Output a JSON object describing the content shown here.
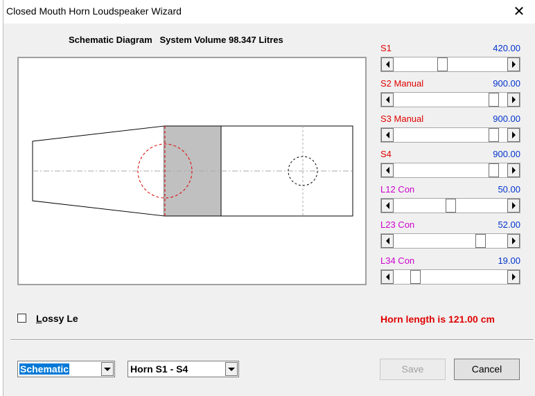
{
  "window": {
    "title": "Closed Mouth Horn Loudspeaker Wizard",
    "close_glyph": "✕"
  },
  "diagram": {
    "heading": "Schematic Diagram   System Volume 98.347 Litres"
  },
  "sliders": [
    {
      "label": "S1",
      "value": "420.00",
      "color": "#e00000",
      "level": 0.42
    },
    {
      "label": "S2 Manual",
      "value": "900.00",
      "color": "#e00000",
      "level": 0.92
    },
    {
      "label": "S3 Manual",
      "value": "900.00",
      "color": "#e00000",
      "level": 0.92
    },
    {
      "label": "S4",
      "value": "900.00",
      "color": "#e00000",
      "level": 0.92
    },
    {
      "label": "L12 Con",
      "value": "50.00",
      "color": "#cc00cc",
      "level": 0.5
    },
    {
      "label": "L23 Con",
      "value": "52.00",
      "color": "#cc00cc",
      "level": 0.79
    },
    {
      "label": "L34 Con",
      "value": "19.00",
      "color": "#cc00cc",
      "level": 0.16
    }
  ],
  "lossy": {
    "label": "Lossy Le",
    "checked": false
  },
  "horn_length": "Horn length is 121.00 cm",
  "view_select": {
    "value": "Schematic"
  },
  "horn_select": {
    "value": "Horn S1 - S4"
  },
  "buttons": {
    "save": "Save",
    "cancel": "Cancel"
  }
}
